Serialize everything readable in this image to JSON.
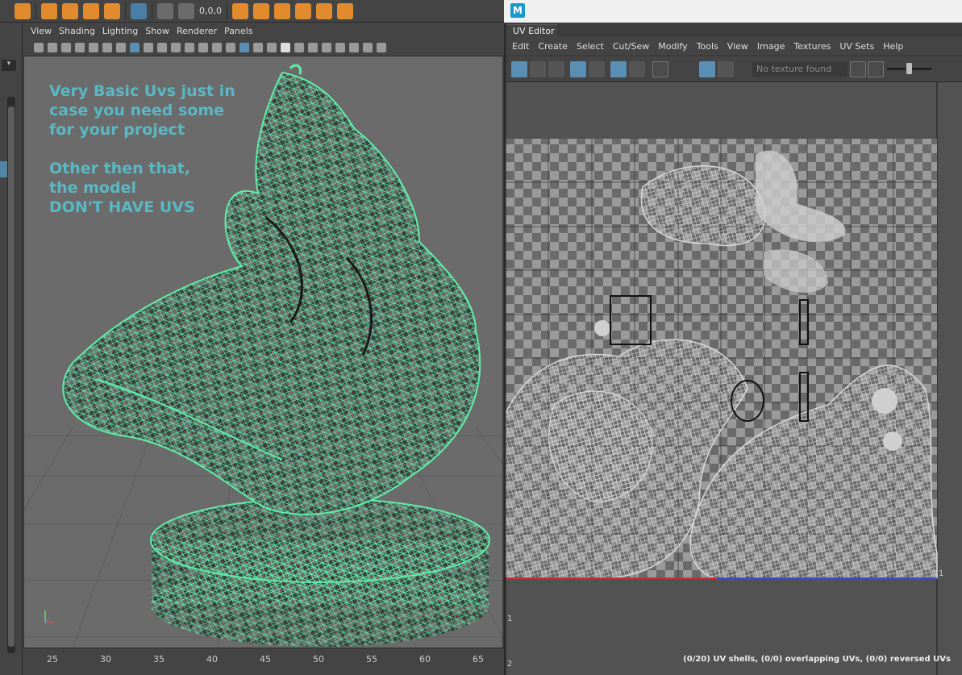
{
  "shelf": {
    "coord": "0,0,0"
  },
  "viewport": {
    "menus": [
      "View",
      "Shading",
      "Lighting",
      "Show",
      "Renderer",
      "Panels"
    ],
    "overlay_lines": [
      "Very Basic Uvs just in",
      "case you need some",
      "for your project",
      "",
      "Other then that,",
      "the model",
      "DON'T HAVE UVS"
    ],
    "ruler_ticks": [
      "25",
      "30",
      "35",
      "40",
      "45",
      "50",
      "55",
      "60",
      "65"
    ]
  },
  "uv_editor": {
    "app_logo": "M",
    "tab": "UV Editor",
    "menus": [
      "Edit",
      "Create",
      "Select",
      "Cut/Sew",
      "Modify",
      "Tools",
      "View",
      "Image",
      "Textures",
      "UV Sets",
      "Help"
    ],
    "texture_field": "No texture found",
    "tick_one_right": "1",
    "tick_one_left": "1",
    "tick_two_left": "2",
    "status": "(0/20) UV shells, (0/0) overlapping UVs, (0/0) reversed UVs"
  },
  "colors": {
    "wireframe": "#61eba8",
    "overlay_text": "#5ab8c4",
    "uv_wire": "#d8d8d8"
  }
}
